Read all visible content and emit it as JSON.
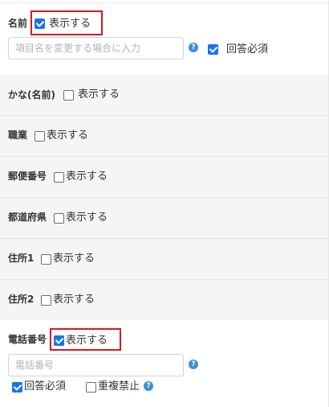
{
  "show_label": "表示する",
  "required_label": "回答必須",
  "no_duplicate_label": "重複禁止",
  "help_icon_char": "?",
  "colors": {
    "accent": "#1a73e8",
    "highlight_border": "#d9181e",
    "section_bg": "#f5f5f5",
    "help_icon": "#3d8fd8"
  },
  "fields": {
    "name": {
      "label": "名前",
      "show": true,
      "placeholder": "項目名を変更する場合に入力",
      "required": true
    },
    "kana": {
      "label": "かな(名前)",
      "show": false
    },
    "job": {
      "label": "職業",
      "show": false
    },
    "postal": {
      "label": "郵便番号",
      "show": false
    },
    "prefecture": {
      "label": "都道府県",
      "show": false
    },
    "address1": {
      "label": "住所1",
      "show": false
    },
    "address2": {
      "label": "住所2",
      "show": false
    },
    "phone": {
      "label": "電話番号",
      "show": true,
      "placeholder": "電話番号",
      "required": true,
      "no_duplicate": false
    }
  }
}
